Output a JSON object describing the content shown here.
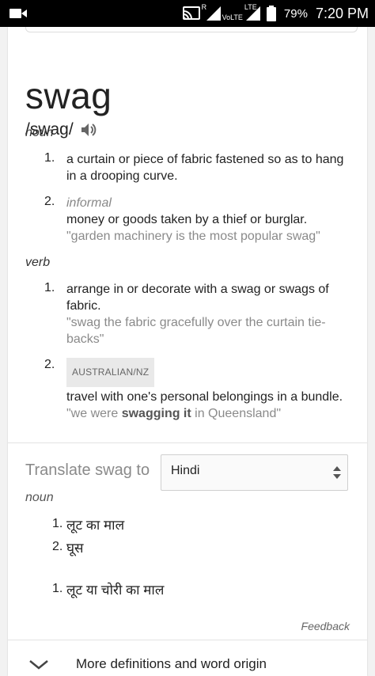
{
  "status_bar": {
    "left_icon": "video-camera-icon",
    "cast_icon": "cast-icon",
    "roaming": "R",
    "volte": "VoLTE",
    "lte": "LTE",
    "battery": "79%",
    "time": "7:20 PM"
  },
  "entry": {
    "word": "swag",
    "phonetic": "/swag/",
    "speaker_icon": "speaker-icon"
  },
  "noun": {
    "label": "noun",
    "senses": [
      {
        "number": "1.",
        "definition": "a curtain or piece of fabric fastened so as to hang in a drooping curve."
      },
      {
        "number": "2.",
        "label": "informal",
        "definition": "money or goods taken by a thief or burglar.",
        "example": "\"garden machinery is the most popular swag\""
      }
    ]
  },
  "verb": {
    "label": "verb",
    "senses": [
      {
        "number": "1.",
        "definition": "arrange in or decorate with a swag or swags of fabric.",
        "example": "\"swag the fabric gracefully over the curtain tie-backs\""
      },
      {
        "number": "2.",
        "badge": "AUSTRALIAN/NZ",
        "definition": "travel with one's personal belongings in a bundle.",
        "example_pre": "\"we were ",
        "example_bold": "swagging it",
        "example_post": " in Queensland\""
      }
    ]
  },
  "translate": {
    "label": "Translate swag to",
    "selected_language": "Hindi",
    "noun_label": "noun",
    "items": [
      {
        "number": "1.",
        "text": "लूट का माल"
      },
      {
        "number": "2.",
        "text": "घूस"
      }
    ],
    "verb_items": [
      {
        "number": "1.",
        "text": "लूट या चोरी का माल"
      }
    ]
  },
  "feedback": "Feedback",
  "more": {
    "icon": "chevron-down-icon",
    "label": "More definitions and word origin"
  }
}
